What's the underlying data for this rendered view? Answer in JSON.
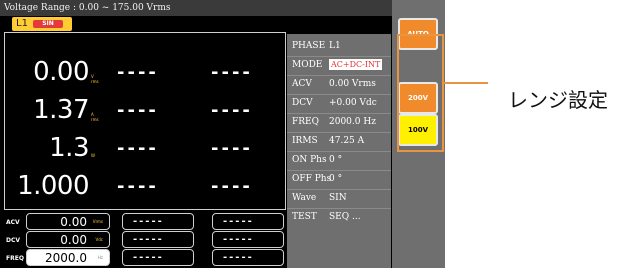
{
  "title": "Voltage Range : 0.00 ~ 175.00 Vrms",
  "channel": {
    "label": "L1",
    "mode": "SIN"
  },
  "measurements": [
    {
      "value": "0.00",
      "unit": "V rms"
    },
    {
      "value": "1.37",
      "unit": "A rms"
    },
    {
      "value": "1.3",
      "unit": "W"
    },
    {
      "value": "1.000",
      "unit": ""
    }
  ],
  "dashes": "----",
  "settings": [
    {
      "label": "ACV",
      "value": "0.00",
      "unit": "Vrms",
      "selected": false
    },
    {
      "label": "DCV",
      "value": "0.00",
      "unit": "Vdc",
      "selected": false
    },
    {
      "label": "FREQ",
      "value": "2000.0",
      "unit": "Hz",
      "selected": true
    }
  ],
  "setting_dashes": "-----",
  "params": [
    {
      "key": "PHASE",
      "value": "L1"
    },
    {
      "key": "MODE",
      "value": "AC+DC-INT",
      "highlight": true
    },
    {
      "key": "ACV",
      "value": "0.00 Vrms"
    },
    {
      "key": "DCV",
      "value": "+0.00 Vdc"
    },
    {
      "key": "FREQ",
      "value": "2000.0 Hz"
    },
    {
      "key": "IRMS",
      "value": "47.25 A"
    },
    {
      "key": "ON Phs",
      "value": "0 °"
    },
    {
      "key": "OFF Phs",
      "value": "0 °"
    },
    {
      "key": "Wave",
      "value": "SIN"
    },
    {
      "key": "TEST",
      "value": "SEQ ..."
    }
  ],
  "softkeys": {
    "auto": "AUTO",
    "v200": "200V",
    "v100": "100V"
  },
  "callout": "レンジ設定",
  "colors": {
    "accent": "#f18a2b",
    "selected": "#fff000",
    "callout": "#e89442",
    "panel": "#6f6f6f"
  }
}
